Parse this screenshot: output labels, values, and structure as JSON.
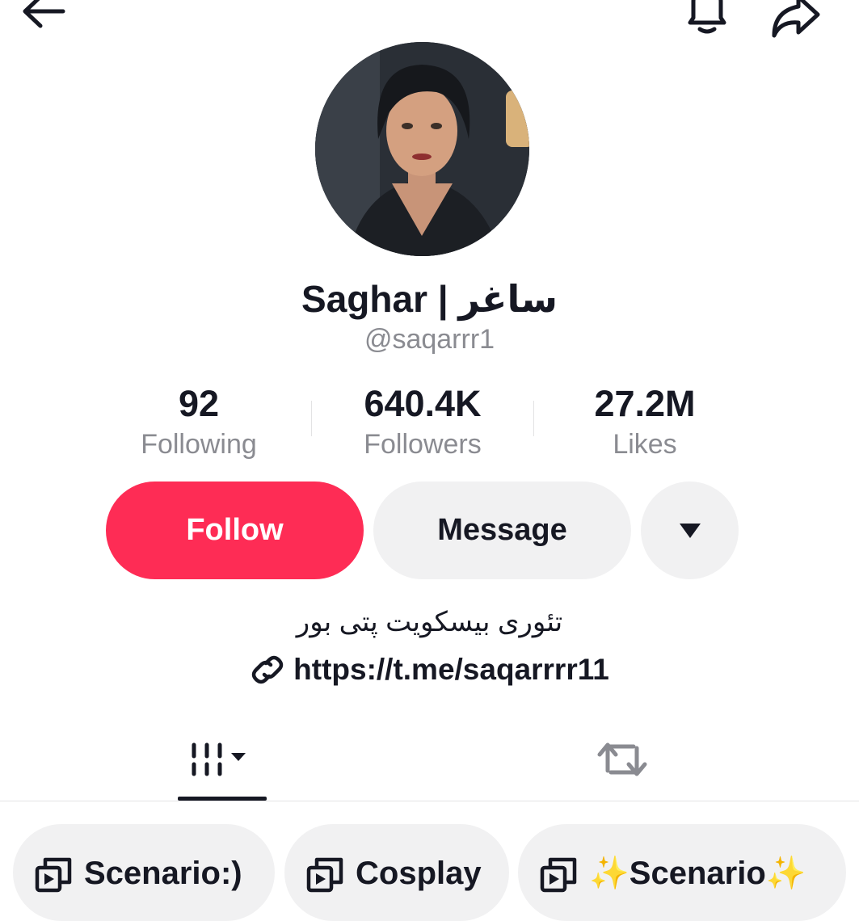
{
  "header": {
    "back_icon": "arrow-left-icon",
    "bell_icon": "bell-icon",
    "share_icon": "share-arrow-icon"
  },
  "profile": {
    "display_name": "Saghar | ساغر",
    "username": "@saqarrr1",
    "bio": "تئوری بیسکویت پتی بور",
    "link": "https://t.me/saqarrrr11"
  },
  "stats": [
    {
      "value": "92",
      "label": "Following"
    },
    {
      "value": "640.4K",
      "label": "Followers"
    },
    {
      "value": "27.2M",
      "label": "Likes"
    }
  ],
  "actions": {
    "follow_label": "Follow",
    "message_label": "Message",
    "more_icon": "caret-down-icon"
  },
  "tabs": {
    "videos_icon": "video-grid-icon",
    "reposts_icon": "repost-icon",
    "active": "videos"
  },
  "playlists": [
    {
      "label": "Scenario:)"
    },
    {
      "label": "Cosplay"
    },
    {
      "label": "✨Scenario✨"
    }
  ],
  "colors": {
    "accent": "#fe2c55",
    "secondary_button": "#f1f1f2",
    "muted_text": "#8a8b91",
    "text": "#161823"
  }
}
